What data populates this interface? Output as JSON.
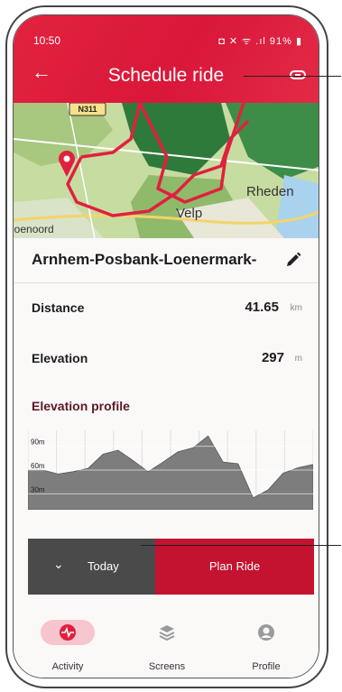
{
  "status": {
    "time": "10:50",
    "icons": "◘ ✕ ᯤ .ıl 91% ▮"
  },
  "header": {
    "title": "Schedule ride"
  },
  "map": {
    "road_label": "N311",
    "town_labels": [
      "Rheden",
      "Velp",
      "loenoord"
    ]
  },
  "route": {
    "name": "Arnhem-Posbank-Loenermark-"
  },
  "stats": {
    "distance_label": "Distance",
    "distance_value": "41.65",
    "distance_unit": "km",
    "elevation_label": "Elevation",
    "elevation_value": "297",
    "elevation_unit": "m"
  },
  "elevation_profile": {
    "title": "Elevation profile",
    "y_ticks": [
      "90m",
      "60m",
      "30m"
    ]
  },
  "chart_data": {
    "type": "area",
    "y_ticks": [
      "90m",
      "60m",
      "30m"
    ],
    "y_tick_values": [
      90,
      60,
      30
    ],
    "ylim": [
      10,
      110
    ],
    "values": [
      60,
      60,
      55,
      58,
      62,
      80,
      85,
      72,
      58,
      70,
      83,
      88,
      103,
      70,
      68,
      25,
      35,
      56,
      63,
      67
    ]
  },
  "actions": {
    "date_label": "Today",
    "plan_label": "Plan Ride"
  },
  "nav": {
    "activity": "Activity",
    "screens": "Screens",
    "profile": "Profile"
  },
  "colors": {
    "brand_red": "#e2233e",
    "plan_red": "#c41231",
    "dark_btn": "#4a4a4a",
    "title_dark": "#5a1a24"
  }
}
